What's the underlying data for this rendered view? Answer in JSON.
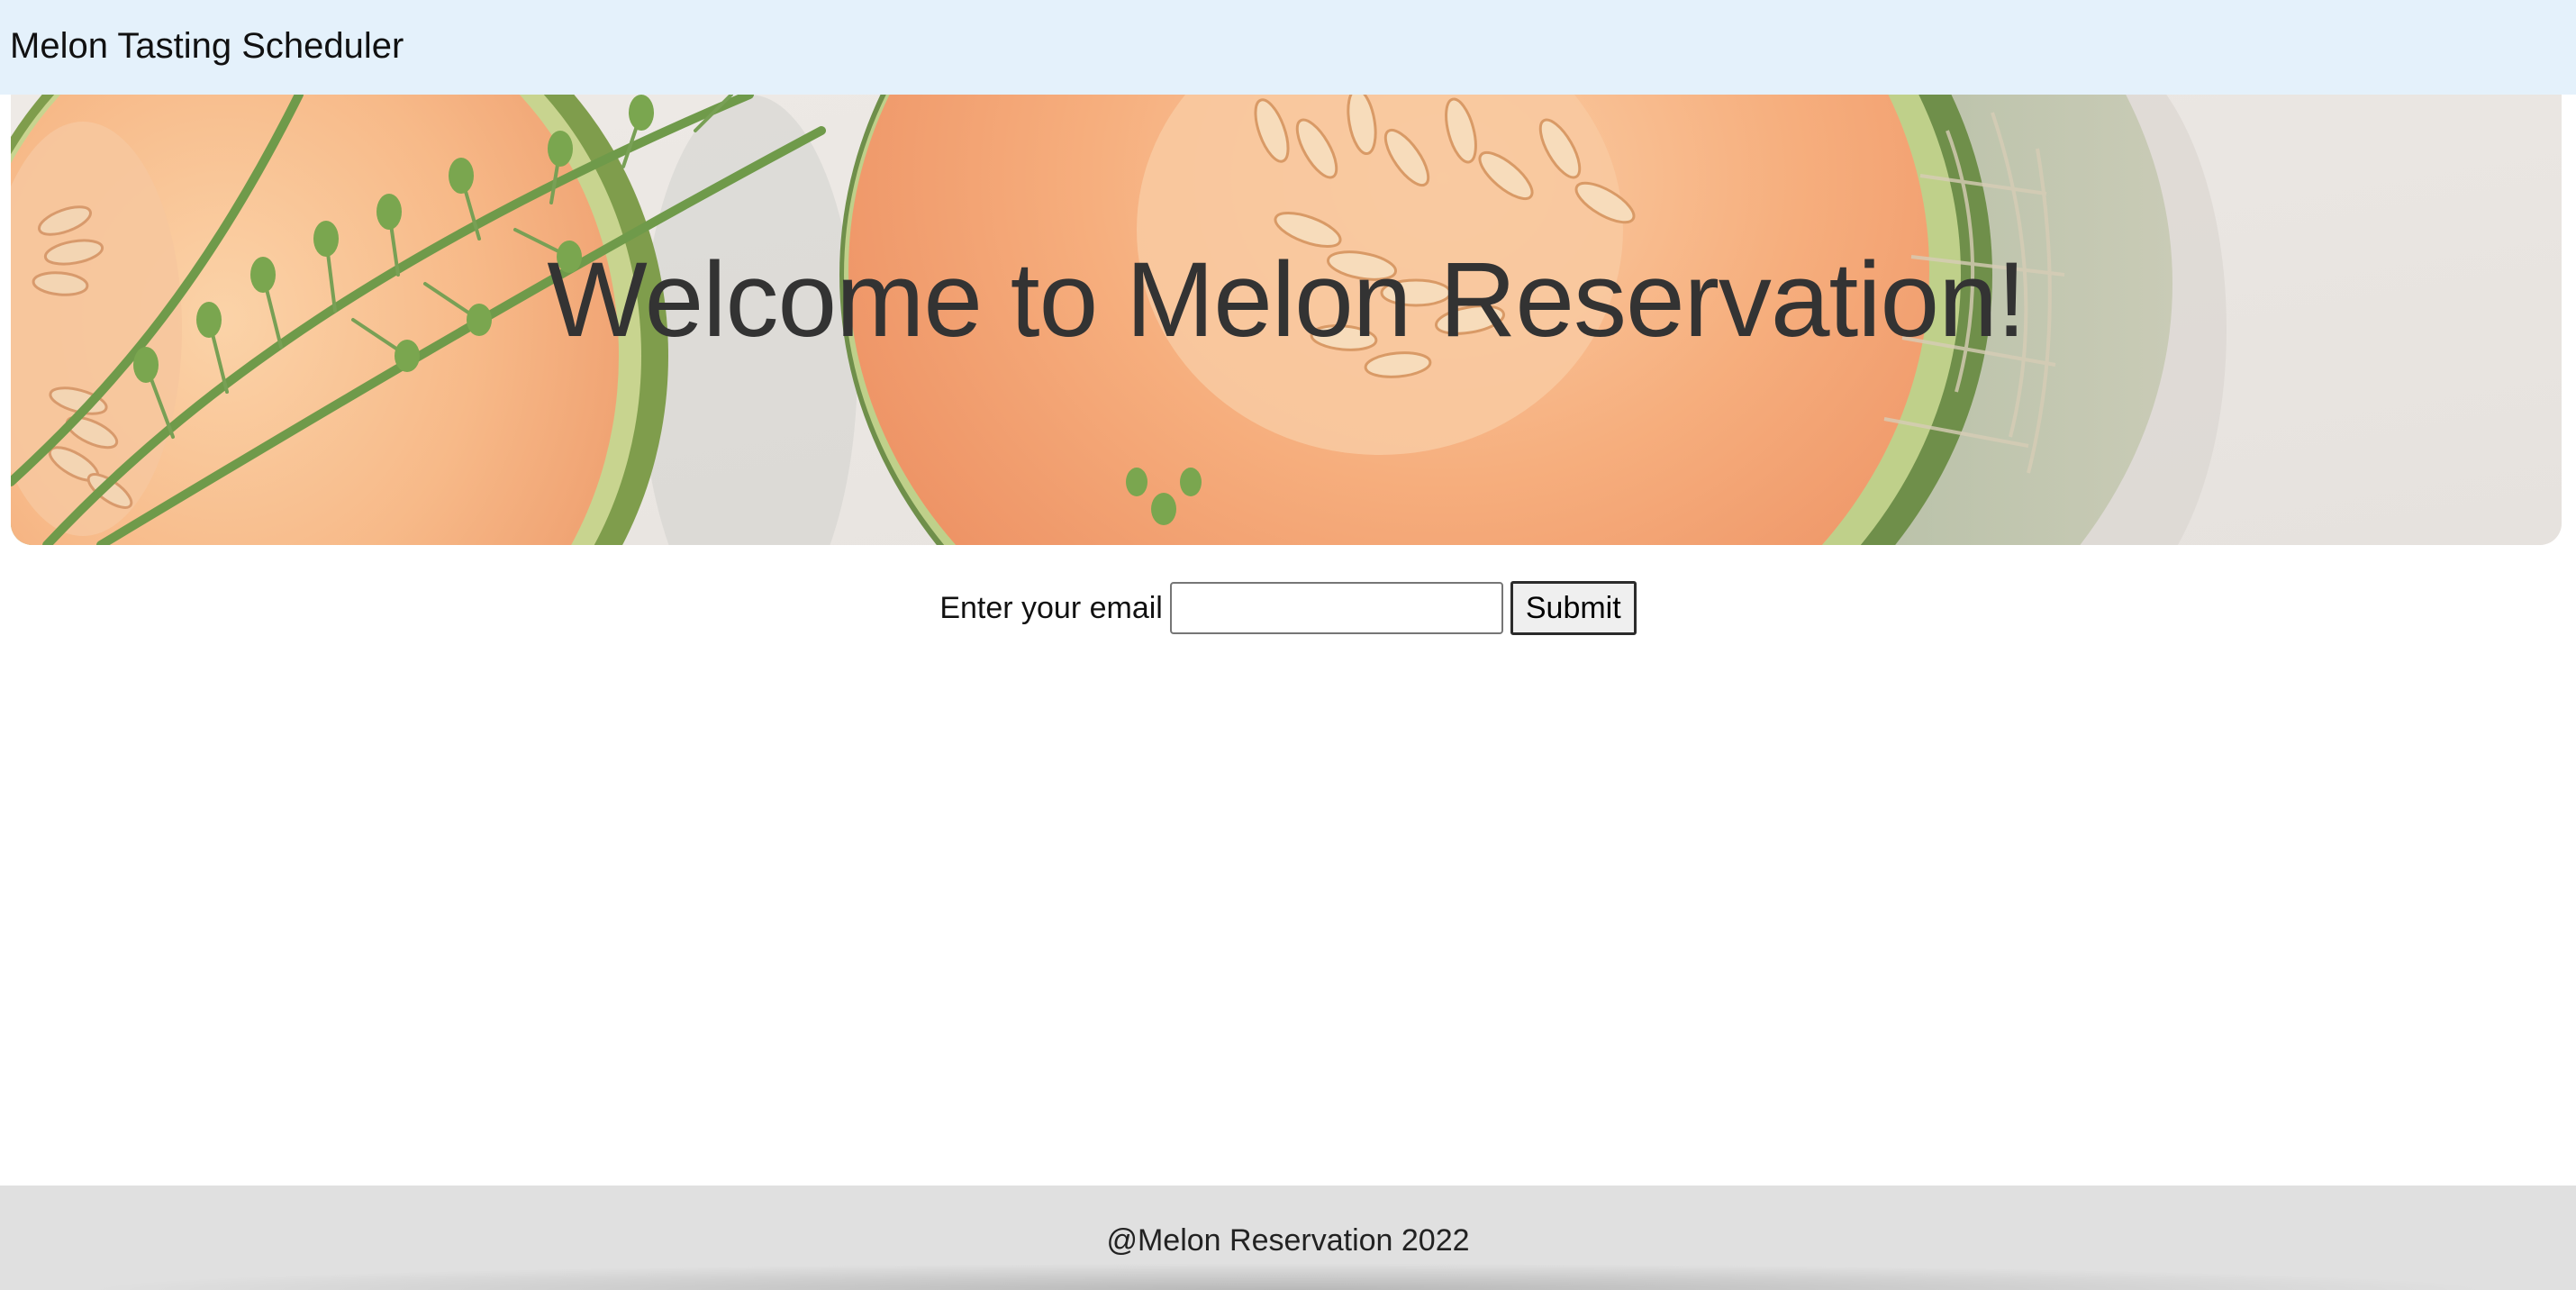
{
  "navbar": {
    "brand": "Melon Tasting Scheduler"
  },
  "hero": {
    "title": "Welcome to Melon Reservation!"
  },
  "form": {
    "label": "Enter your email",
    "email_value": "",
    "email_placeholder": "",
    "submit_label": "Submit"
  },
  "footer": {
    "text": "@Melon Reservation 2022"
  },
  "colors": {
    "navbar_bg": "#e4f1fb",
    "footer_bg": "#e0e0e0",
    "hero_title": "#333333",
    "melon_flesh": "#f6b07f",
    "melon_rind": "#6f8f4a"
  }
}
